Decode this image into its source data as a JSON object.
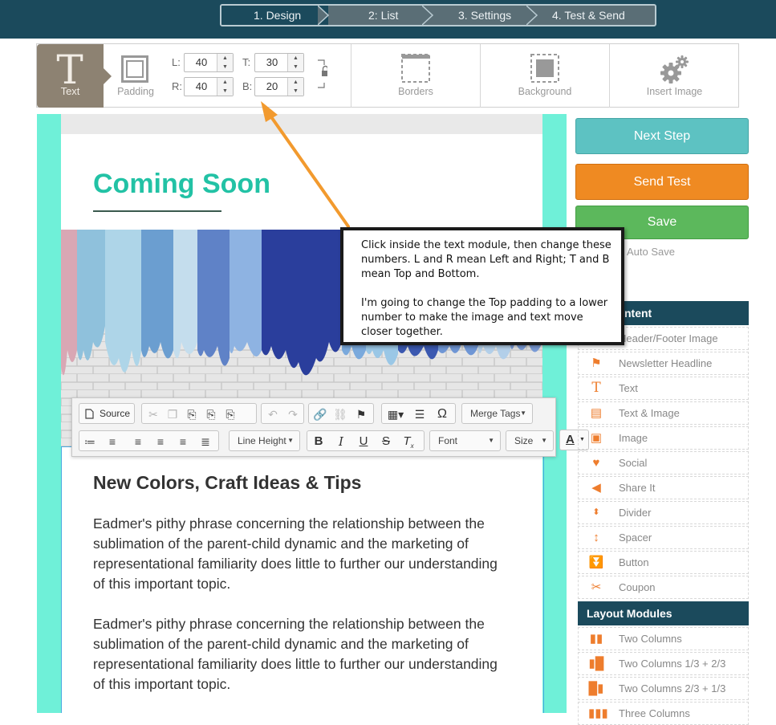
{
  "steps": [
    {
      "label": "1. Design",
      "active": true
    },
    {
      "label": "2: List",
      "active": false
    },
    {
      "label": "3. Settings",
      "active": false
    },
    {
      "label": "4. Test & Send",
      "active": false
    }
  ],
  "toolbar": {
    "text_label": "Text",
    "padding_label": "Padding",
    "left_label": "L:",
    "left_value": "40",
    "right_label": "R:",
    "right_value": "40",
    "top_label": "T:",
    "top_value": "30",
    "bottom_label": "B:",
    "bottom_value": "20",
    "borders_label": "Borders",
    "background_label": "Background",
    "insert_image_label": "Insert Image"
  },
  "email": {
    "title": "Coming Soon",
    "headline": "New Colors, Craft Ideas & Tips",
    "paragraphs": [
      "Eadmer's pithy phrase concerning the relationship between the sublimation of the parent-child dynamic and the marketing of representational familiarity does little to further our understanding of this important topic.",
      "Eadmer's pithy phrase concerning the relationship between the sublimation of the parent-child dynamic and the marketing of representational familiarity does little to further our understanding of this important topic."
    ]
  },
  "editor": {
    "source_label": "Source",
    "merge_tags_label": "Merge Tags",
    "line_height_label": "Line Height",
    "font_label": "Font",
    "size_label": "Size"
  },
  "sidebar": {
    "next_step": "Next Step",
    "send_test": "Send Test",
    "save": "Save",
    "auto_save": "Auto Save",
    "content_heading": "ntent",
    "content_modules": [
      {
        "label": "Header/Footer Image",
        "icon": "image-icon"
      },
      {
        "label": "Newsletter Headline",
        "icon": "flag-icon"
      },
      {
        "label": "Text",
        "icon": "text-icon"
      },
      {
        "label": "Text & Image",
        "icon": "text-image-icon"
      },
      {
        "label": "Image",
        "icon": "image-icon"
      },
      {
        "label": "Social",
        "icon": "heart-icon"
      },
      {
        "label": "Share It",
        "icon": "megaphone-icon"
      },
      {
        "label": "Divider",
        "icon": "divider-icon"
      },
      {
        "label": "Spacer",
        "icon": "spacer-icon"
      },
      {
        "label": "Button",
        "icon": "button-icon"
      },
      {
        "label": "Coupon",
        "icon": "scissors-icon"
      }
    ],
    "layout_heading": "Layout Modules",
    "layout_modules": [
      {
        "label": "Two Columns",
        "icon": "two-columns-icon"
      },
      {
        "label": "Two Columns 1/3 + 2/3",
        "icon": "two-columns-icon"
      },
      {
        "label": "Two Columns 2/3 + 1/3",
        "icon": "two-columns-icon"
      },
      {
        "label": "Three Columns",
        "icon": "three-columns-icon"
      }
    ]
  },
  "callout": {
    "line1": "Click inside the text module, then change these numbers. L and R mean Left and Right; T and B mean Top and Bottom.",
    "line2": "I'm going to change the Top padding to a lower number to make the image and text move closer together."
  },
  "colors": {
    "nav_bg": "#1b4a5c",
    "accent_teal": "#22c2a5",
    "canvas_bg": "#6ff0d8",
    "arrow": "#f29a2e"
  }
}
